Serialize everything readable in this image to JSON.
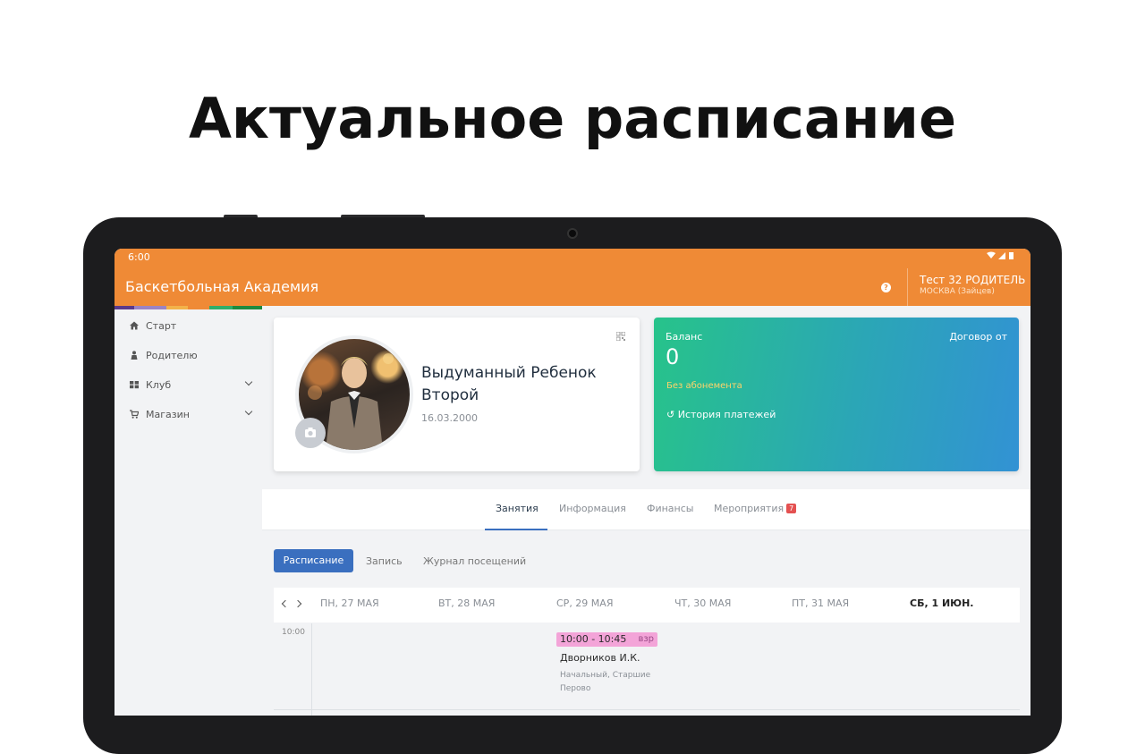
{
  "headline": "Актуальное расписание",
  "status_bar": {
    "time": "6:00",
    "icons": "▾◢▮"
  },
  "appbar": {
    "title": "Баскетбольная Академия",
    "help_icon": "?",
    "user_name": "Тест 32 РОДИТЕЛЬ",
    "user_location": "МОСКВА (Зайцев)",
    "color": "#ef8a36"
  },
  "sidebar": {
    "items": [
      {
        "label": "Старт",
        "icon": "home-icon"
      },
      {
        "label": "Родителю",
        "icon": "user-icon"
      },
      {
        "label": "Клуб",
        "icon": "grid-icon",
        "expandable": true
      },
      {
        "label": "Магазин",
        "icon": "cart-icon",
        "expandable": true
      }
    ]
  },
  "profile": {
    "name": "Выдуманный Ребенок Второй",
    "dob": "16.03.2000"
  },
  "balance": {
    "label": "Баланс",
    "value": "0",
    "contract": "Договор от",
    "no_subscription": "Без абонемента",
    "history": "История платежей",
    "history_icon": "↺"
  },
  "tabs": {
    "items": [
      {
        "label": "Занятия",
        "active": true
      },
      {
        "label": "Информация"
      },
      {
        "label": "Финансы"
      },
      {
        "label": "Мероприятия",
        "badge": "7"
      }
    ]
  },
  "subnav": {
    "items": [
      {
        "label": "Расписание",
        "active": true
      },
      {
        "label": "Запись"
      },
      {
        "label": "Журнал посещений"
      }
    ]
  },
  "calendar": {
    "days": [
      "ПН, 27 МАЯ",
      "ВТ, 28 МАЯ",
      "СР, 29 МАЯ",
      "ЧТ, 30 МАЯ",
      "ПТ, 31 МАЯ",
      "СБ, 1 ИЮН."
    ],
    "today_index": 5,
    "time_label": "10:00",
    "event": {
      "time": "10:00 - 10:45",
      "type": "взр",
      "trainer": "Дворников И.К.",
      "group": "Начальный, Старшие",
      "location": "Перово",
      "color": "#f3a4d8"
    }
  }
}
